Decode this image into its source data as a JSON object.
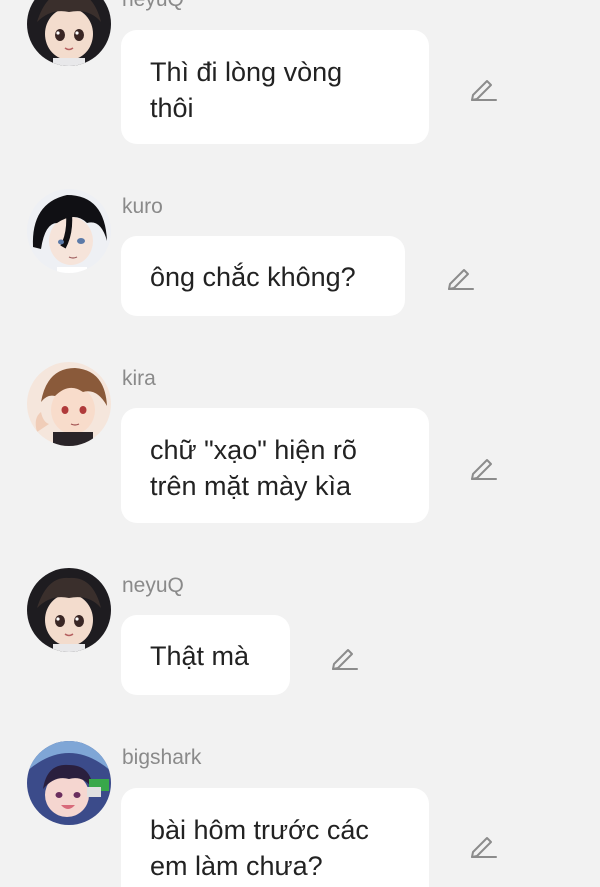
{
  "messages": [
    {
      "username": "neyuQ",
      "text_lines": [
        "Thì đi lòng vòng",
        "thôi"
      ],
      "avatar": "neyuq-avatar"
    },
    {
      "username": "kuro",
      "text_lines": [
        "ông chắc không?"
      ],
      "avatar": "kuro-avatar"
    },
    {
      "username": "kira",
      "text_lines": [
        "chữ \"xạo\" hiện rõ",
        "trên mặt mày kìa"
      ],
      "avatar": "kira-avatar"
    },
    {
      "username": "neyuQ",
      "text_lines": [
        "Thật mà"
      ],
      "avatar": "neyuq-avatar"
    },
    {
      "username": "bigshark",
      "text_lines": [
        "bài hôm trước các",
        "em làm chưa?"
      ],
      "avatar": "bigshark-avatar"
    }
  ],
  "icons": {
    "edit": "pencil-edit-icon"
  },
  "colors": {
    "background": "#f2f2f2",
    "bubble": "#ffffff",
    "username": "#8a8a8a",
    "text": "#222222",
    "icon": "#8c8c8c"
  }
}
